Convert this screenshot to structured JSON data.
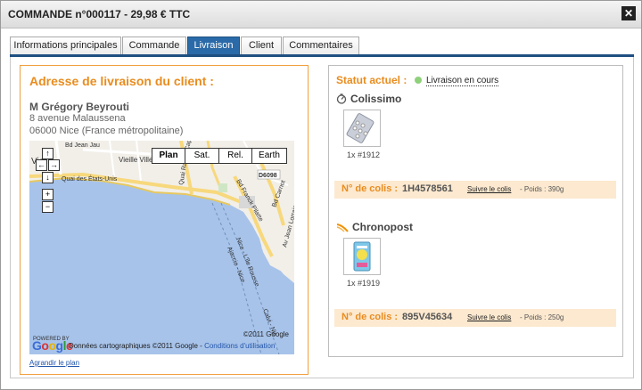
{
  "window": {
    "title": "COMMANDE n°000117 - 29,98 €  TTC",
    "close_glyph": "✕"
  },
  "tabs": [
    {
      "label": "Informations principales",
      "active": false
    },
    {
      "label": "Commande",
      "active": false
    },
    {
      "label": "Livraison",
      "active": true
    },
    {
      "label": "Client",
      "active": false
    },
    {
      "label": "Commentaires",
      "active": false
    }
  ],
  "address": {
    "title": "Adresse de livraison du client :",
    "name": "M Grégory Beyrouti",
    "line1": "8 avenue Malaussena",
    "line2": "06000 Nice (France métropolitaine)"
  },
  "map": {
    "buttons": [
      "Plan",
      "Sat.",
      "Rel.",
      "Earth"
    ],
    "selected": "Plan",
    "labels": {
      "vieille_ville": "Vieille Ville",
      "jean_jaures": "Bd Jean Jau",
      "quai_etats_unis": "Quai des États-Unis",
      "quai_rauba": "Quai Rauba Capeù",
      "franck_pilatte": "Bd Franck Pilatte",
      "carnot": "Bd Carnot",
      "lorrain": "Av Jean Lorrain",
      "d6098": "D6098",
      "nice_ile_rousse": "Nice - L'île Rousse",
      "ajaccio_nice": "Ajaccio - Nice",
      "calvi": "Calvi - Nic",
      "jean_jaures_2": "Bd Jean Jau",
      "vieux_nice": "Vieil"
    },
    "copyright_corner": "©2011 Google",
    "powered_by": "POWERED BY",
    "logo": "Google",
    "footer_text": "Données cartographiques ©2011 Google - ",
    "footer_link": "Conditions d'utilisation",
    "enlarge_link": "Agrandir le plan",
    "colors": {
      "sea": "#a7c3ea",
      "land": "#f2efe9",
      "road": "#f7d87c"
    }
  },
  "shipping": {
    "status_label": "Statut actuel :",
    "status_value": "Livraison en cours",
    "status_color": "#8fd17a",
    "packages": [
      {
        "carrier": "Colissimo",
        "icon": "stopwatch-icon",
        "qty": "1x #1912",
        "colis_label": "N° de colis :",
        "colis_number": "1H4578561",
        "track_link": "Suivre le colis",
        "weight": "- Poids : 390g"
      },
      {
        "carrier": "Chronopost",
        "icon": "chronopost-swoosh-icon",
        "qty": "1x #1919",
        "colis_label": "N° de colis :",
        "colis_number": "895V45634",
        "track_link": "Suivre le colis",
        "weight": "- Poids : 250g"
      }
    ]
  },
  "colors": {
    "accent": "#e98c1e",
    "tab_active": "#2b6aa8",
    "tab_underline": "#1f4f82",
    "colis_bg": "#fce9cf"
  }
}
